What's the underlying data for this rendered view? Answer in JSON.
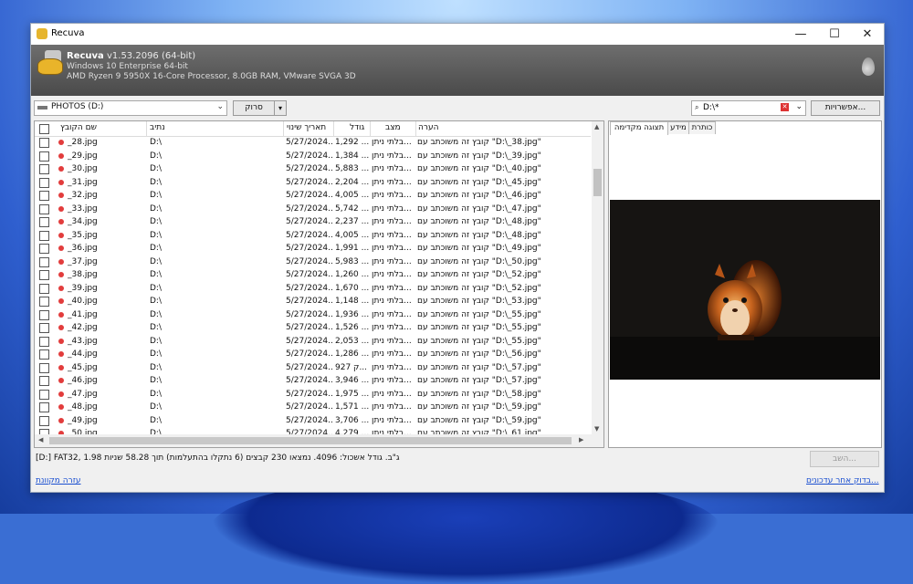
{
  "window": {
    "title": "Recuva",
    "minimize": "—",
    "maximize": "☐",
    "close": "✕"
  },
  "header": {
    "app_name": "Recuva",
    "version": "v1.53.2096 (64-bit)",
    "os": "Windows 10 Enterprise 64-bit",
    "hardware": "AMD Ryzen 9 5950X 16-Core Processor, 8.0GB RAM, VMware SVGA 3D"
  },
  "toolbar": {
    "drive": "PHOTOS (D:)",
    "scan_label": "סרוק",
    "filter_value": "D:\\*",
    "options_label": "אפשרויות..."
  },
  "columns": {
    "name": "שם הקובץ",
    "path": "נתיב",
    "modified": "תאריך שינוי",
    "size": "גודל",
    "state": "מצב",
    "comment": "הערה"
  },
  "rows": [
    {
      "name": "_28.jpg",
      "path": "D:\\",
      "date": "5/27/2024...",
      "size": "1,292 ...",
      "state": "בלתי ניתן...",
      "comment": "קובץ זה משוכתב עם \"D:\\_38.jpg\""
    },
    {
      "name": "_29.jpg",
      "path": "D:\\",
      "date": "5/27/2024...",
      "size": "1,384 ...",
      "state": "בלתי ניתן...",
      "comment": "קובץ זה משוכתב עם \"D:\\_39.jpg\""
    },
    {
      "name": "_30.jpg",
      "path": "D:\\",
      "date": "5/27/2024...",
      "size": "5,883 ...",
      "state": "בלתי ניתן...",
      "comment": "קובץ זה משוכתב עם \"D:\\_40.jpg\""
    },
    {
      "name": "_31.jpg",
      "path": "D:\\",
      "date": "5/27/2024...",
      "size": "2,204 ...",
      "state": "בלתי ניתן...",
      "comment": "קובץ זה משוכתב עם \"D:\\_45.jpg\""
    },
    {
      "name": "_32.jpg",
      "path": "D:\\",
      "date": "5/27/2024...",
      "size": "4,005 ...",
      "state": "בלתי ניתן...",
      "comment": "קובץ זה משוכתב עם \"D:\\_46.jpg\""
    },
    {
      "name": "_33.jpg",
      "path": "D:\\",
      "date": "5/27/2024...",
      "size": "5,742 ...",
      "state": "בלתי ניתן...",
      "comment": "קובץ זה משוכתב עם \"D:\\_47.jpg\""
    },
    {
      "name": "_34.jpg",
      "path": "D:\\",
      "date": "5/27/2024...",
      "size": "2,237 ...",
      "state": "בלתי ניתן...",
      "comment": "קובץ זה משוכתב עם \"D:\\_48.jpg\""
    },
    {
      "name": "_35.jpg",
      "path": "D:\\",
      "date": "5/27/2024...",
      "size": "4,005 ...",
      "state": "בלתי ניתן...",
      "comment": "קובץ זה משוכתב עם \"D:\\_48.jpg\""
    },
    {
      "name": "_36.jpg",
      "path": "D:\\",
      "date": "5/27/2024...",
      "size": "1,991 ...",
      "state": "בלתי ניתן...",
      "comment": "קובץ זה משוכתב עם \"D:\\_49.jpg\""
    },
    {
      "name": "_37.jpg",
      "path": "D:\\",
      "date": "5/27/2024...",
      "size": "5,983 ...",
      "state": "בלתי ניתן...",
      "comment": "קובץ זה משוכתב עם \"D:\\_50.jpg\""
    },
    {
      "name": "_38.jpg",
      "path": "D:\\",
      "date": "5/27/2024...",
      "size": "1,260 ...",
      "state": "בלתי ניתן...",
      "comment": "קובץ זה משוכתב עם \"D:\\_52.jpg\""
    },
    {
      "name": "_39.jpg",
      "path": "D:\\",
      "date": "5/27/2024...",
      "size": "1,670 ...",
      "state": "בלתי ניתן...",
      "comment": "קובץ זה משוכתב עם \"D:\\_52.jpg\""
    },
    {
      "name": "_40.jpg",
      "path": "D:\\",
      "date": "5/27/2024...",
      "size": "1,148 ...",
      "state": "בלתי ניתן...",
      "comment": "קובץ זה משוכתב עם \"D:\\_53.jpg\""
    },
    {
      "name": "_41.jpg",
      "path": "D:\\",
      "date": "5/27/2024...",
      "size": "1,936 ...",
      "state": "בלתי ניתן...",
      "comment": "קובץ זה משוכתב עם \"D:\\_55.jpg\""
    },
    {
      "name": "_42.jpg",
      "path": "D:\\",
      "date": "5/27/2024...",
      "size": "1,526 ...",
      "state": "בלתי ניתן...",
      "comment": "קובץ זה משוכתב עם \"D:\\_55.jpg\""
    },
    {
      "name": "_43.jpg",
      "path": "D:\\",
      "date": "5/27/2024...",
      "size": "2,053 ...",
      "state": "בלתי ניתן...",
      "comment": "קובץ זה משוכתב עם \"D:\\_55.jpg\""
    },
    {
      "name": "_44.jpg",
      "path": "D:\\",
      "date": "5/27/2024...",
      "size": "1,286 ...",
      "state": "בלתי ניתן...",
      "comment": "קובץ זה משוכתב עם \"D:\\_56.jpg\""
    },
    {
      "name": "_45.jpg",
      "path": "D:\\",
      "date": "5/27/2024...",
      "size": "927 ק...",
      "state": "בלתי ניתן...",
      "comment": "קובץ זה משוכתב עם \"D:\\_57.jpg\""
    },
    {
      "name": "_46.jpg",
      "path": "D:\\",
      "date": "5/27/2024...",
      "size": "3,946 ...",
      "state": "בלתי ניתן...",
      "comment": "קובץ זה משוכתב עם \"D:\\_57.jpg\""
    },
    {
      "name": "_47.jpg",
      "path": "D:\\",
      "date": "5/27/2024...",
      "size": "1,975 ...",
      "state": "בלתי ניתן...",
      "comment": "קובץ זה משוכתב עם \"D:\\_58.jpg\""
    },
    {
      "name": "_48.jpg",
      "path": "D:\\",
      "date": "5/27/2024...",
      "size": "1,571 ...",
      "state": "בלתי ניתן...",
      "comment": "קובץ זה משוכתב עם \"D:\\_59.jpg\""
    },
    {
      "name": "_49.jpg",
      "path": "D:\\",
      "date": "5/27/2024...",
      "size": "3,706 ...",
      "state": "בלתי ניתן...",
      "comment": "קובץ זה משוכתב עם \"D:\\_59.jpg\""
    },
    {
      "name": "_50.jpg",
      "path": "D:\\",
      "date": "5/27/2024...",
      "size": "4,279 ...",
      "state": "בלתי ניתן...",
      "comment": "קובץ זה משוכתב עם \"D:\\_61.jpg\""
    }
  ],
  "preview_tabs": [
    "תצוגה מקדימה",
    "מידע",
    "כותרת"
  ],
  "status": "[D:] FAT32, 1.98 ג\"ב. גודל אשכול: 4096. נמצאו 230 קבצים (6 נתקלו בהתעלמות) תוך 58.28 שניות",
  "recover_label": "השב...",
  "links": {
    "help": "עזרה מקוונת",
    "updates": "בדוק אחר עדכונים..."
  }
}
